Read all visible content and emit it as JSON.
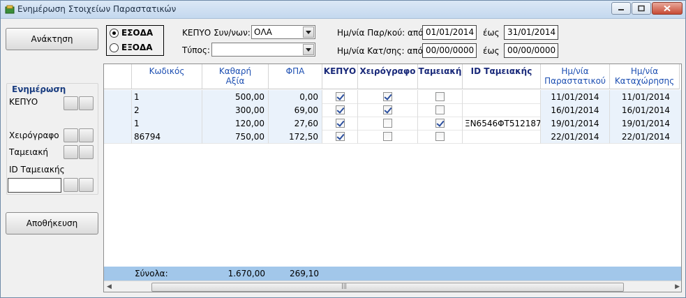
{
  "window": {
    "title": "Ενημέρωση Στοιχείων Παραστατικών"
  },
  "left": {
    "retrieve_label": "Ανάκτηση",
    "group_title": "Ενημέρωση",
    "kepyo_label": "ΚΕΠΥΟ",
    "handwritten_label": "Χειρόγραφο",
    "cash_label": "Ταμειακή",
    "cash_id_label": "ID Ταμειακής",
    "cash_id_value": "",
    "save_label": "Αποθήκευση"
  },
  "filters": {
    "radio_in": "ΕΣΟΔΑ",
    "radio_out": "ΕΞΟΔΑ",
    "radio_selected": "ΕΣΟΔΑ",
    "kepyo_label": "ΚΕΠΥΟ Συν/νων:",
    "kepyo_value": "ΟΛΑ",
    "type_label": "Τύπος:",
    "type_value": "",
    "doc_date_label": "Ημ/νία Παρ/κού: από",
    "doc_date_from": "01/01/2014",
    "doc_date_to_label": "έως",
    "doc_date_to": "31/01/2014",
    "reg_date_label": "Ημ/νία Κατ/σης: από",
    "reg_date_from": "00/00/0000",
    "reg_date_to_label": "έως",
    "reg_date_to": "00/00/0000"
  },
  "grid": {
    "columns": {
      "code": "Κωδικός",
      "net_1": "Καθαρή",
      "net_2": "Αξία",
      "vat": "ΦΠΑ",
      "kepyo": "ΚΕΠΥΟ",
      "handwritten": "Χειρόγραφο",
      "cash": "Ταμειακή",
      "cash_id": "ID Ταμειακής",
      "doc_date_1": "Ημ/νία",
      "doc_date_2": "Παραστατικού",
      "reg_date_1": "Ημ/νία",
      "reg_date_2": "Καταχώρησης"
    },
    "rows": [
      {
        "code": "1",
        "net": "500,00",
        "vat": "0,00",
        "kepyo": true,
        "handwritten": true,
        "cash": false,
        "cash_id": "",
        "doc_date": "11/01/2014",
        "reg_date": "11/01/2014"
      },
      {
        "code": "2",
        "net": "300,00",
        "vat": "69,00",
        "kepyo": true,
        "handwritten": true,
        "cash": false,
        "cash_id": "",
        "doc_date": "16/01/2014",
        "reg_date": "16/01/2014"
      },
      {
        "code": "1",
        "net": "120,00",
        "vat": "27,60",
        "kepyo": true,
        "handwritten": false,
        "cash": true,
        "cash_id": "ΞΝ6546ΦΤ512187",
        "doc_date": "19/01/2014",
        "reg_date": "19/01/2014"
      },
      {
        "code": "86794",
        "net": "750,00",
        "vat": "172,50",
        "kepyo": true,
        "handwritten": false,
        "cash": false,
        "cash_id": "",
        "doc_date": "22/01/2014",
        "reg_date": "22/01/2014"
      }
    ],
    "totals": {
      "label": "Σύνολα:",
      "net": "1.670,00",
      "vat": "269,10"
    }
  }
}
